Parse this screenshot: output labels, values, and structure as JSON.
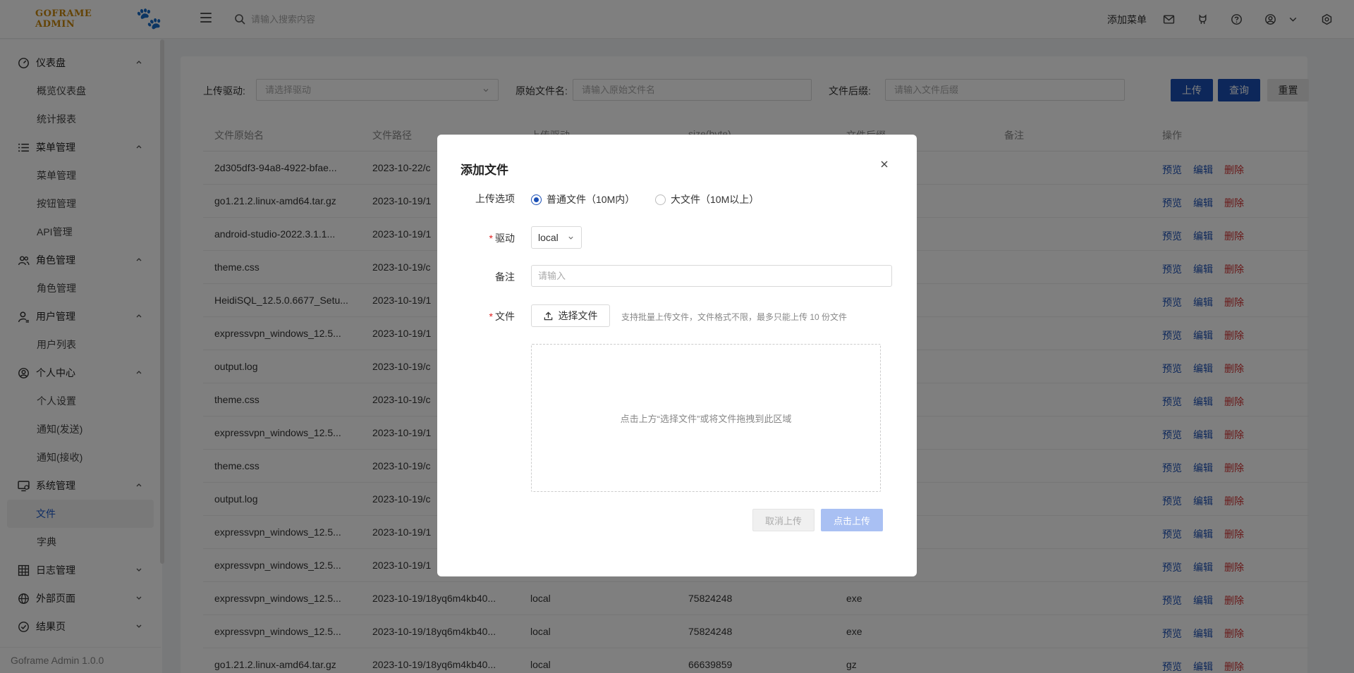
{
  "header": {
    "logo_text": "GOFRAME ADMIN",
    "search_placeholder": "请输入搜索内容",
    "add_menu": "添加菜单"
  },
  "sidebar": {
    "groups": [
      {
        "label": "仪表盘",
        "icon": "dashboard-icon",
        "children": [
          "概览仪表盘",
          "统计报表"
        ]
      },
      {
        "label": "菜单管理",
        "icon": "menu-list-icon",
        "children": [
          "菜单管理",
          "按钮管理",
          "API管理"
        ]
      },
      {
        "label": "角色管理",
        "icon": "users-icon",
        "children": [
          "角色管理"
        ]
      },
      {
        "label": "用户管理",
        "icon": "user-icon",
        "children": [
          "用户列表"
        ]
      },
      {
        "label": "个人中心",
        "icon": "user-circle-icon",
        "children": [
          "个人设置",
          "通知(发送)",
          "通知(接收)"
        ]
      },
      {
        "label": "系统管理",
        "icon": "monitor-icon",
        "children": [
          "文件",
          "字典"
        ]
      },
      {
        "label": "日志管理",
        "icon": "table-icon",
        "children": []
      },
      {
        "label": "外部页面",
        "icon": "globe-icon",
        "children": []
      },
      {
        "label": "结果页",
        "icon": "check-circle-icon",
        "children": []
      }
    ],
    "active_item": "文件",
    "version": "Goframe Admin 1.0.0"
  },
  "filters": {
    "driver_label": "上传驱动:",
    "driver_placeholder": "请选择驱动",
    "orig_name_label": "原始文件名:",
    "orig_name_placeholder": "请输入原始文件名",
    "ext_label": "文件后缀:",
    "ext_placeholder": "请输入文件后缀",
    "upload_btn": "上传",
    "query_btn": "查询",
    "reset_btn": "重置"
  },
  "table": {
    "columns": [
      "文件原始名",
      "文件路径",
      "上传驱动",
      "size(byte)",
      "文件后缀",
      "备注",
      "操作"
    ],
    "actions": {
      "preview": "预览",
      "edit": "编辑",
      "delete": "删除"
    },
    "rows": [
      {
        "name": "2d305df3-94a8-4922-bfae...",
        "path": "2023-10-22/c",
        "driver": "",
        "size": "",
        "ext": ""
      },
      {
        "name": "go1.21.2.linux-amd64.tar.gz",
        "path": "2023-10-19/1",
        "driver": "",
        "size": "",
        "ext": ""
      },
      {
        "name": "android-studio-2022.3.1.1...",
        "path": "2023-10-19/1",
        "driver": "",
        "size": "",
        "ext": ""
      },
      {
        "name": "theme.css",
        "path": "2023-10-19/c",
        "driver": "",
        "size": "",
        "ext": ""
      },
      {
        "name": "HeidiSQL_12.5.0.6677_Setu...",
        "path": "2023-10-19/1",
        "driver": "",
        "size": "",
        "ext": ""
      },
      {
        "name": "expressvpn_windows_12.5...",
        "path": "2023-10-19/1",
        "driver": "",
        "size": "",
        "ext": ""
      },
      {
        "name": "output.log",
        "path": "2023-10-19/c",
        "driver": "",
        "size": "",
        "ext": ""
      },
      {
        "name": "theme.css",
        "path": "2023-10-19/c",
        "driver": "",
        "size": "",
        "ext": ""
      },
      {
        "name": "expressvpn_windows_12.5...",
        "path": "2023-10-19/1",
        "driver": "",
        "size": "",
        "ext": ""
      },
      {
        "name": "theme.css",
        "path": "2023-10-19/c",
        "driver": "",
        "size": "",
        "ext": ""
      },
      {
        "name": "output.log",
        "path": "2023-10-19/c",
        "driver": "",
        "size": "",
        "ext": ""
      },
      {
        "name": "expressvpn_windows_12.5...",
        "path": "2023-10-19/1",
        "driver": "",
        "size": "",
        "ext": ""
      },
      {
        "name": "expressvpn_windows_12.5...",
        "path": "2023-10-19/1",
        "driver": "",
        "size": "",
        "ext": ""
      },
      {
        "name": "expressvpn_windows_12.5...",
        "path": "2023-10-19/18yq6m4kb40...",
        "driver": "local",
        "size": "75824248",
        "ext": "exe"
      },
      {
        "name": "expressvpn_windows_12.5...",
        "path": "2023-10-19/18yq6m4kb40...",
        "driver": "local",
        "size": "75824248",
        "ext": "exe"
      },
      {
        "name": "go1.21.2.linux-amd64.tar.gz",
        "path": "2023-10-19/18yq6m4kb40...",
        "driver": "local",
        "size": "66639859",
        "ext": "gz"
      }
    ]
  },
  "modal": {
    "title": "添加文件",
    "upload_option_label": "上传选项",
    "radio_normal": "普通文件（10M内）",
    "radio_large": "大文件（10M以上）",
    "driver_label": "驱动",
    "driver_value": "local",
    "remark_label": "备注",
    "remark_placeholder": "请输入",
    "file_label": "文件",
    "choose_file_btn": "选择文件",
    "tip": "支持批量上传文件，文件格式不限，最多只能上传 10 份文件",
    "dropzone_text": "点击上方“选择文件”或将文件拖拽到此区域",
    "cancel_btn": "取消上传",
    "confirm_btn": "点击上传"
  }
}
